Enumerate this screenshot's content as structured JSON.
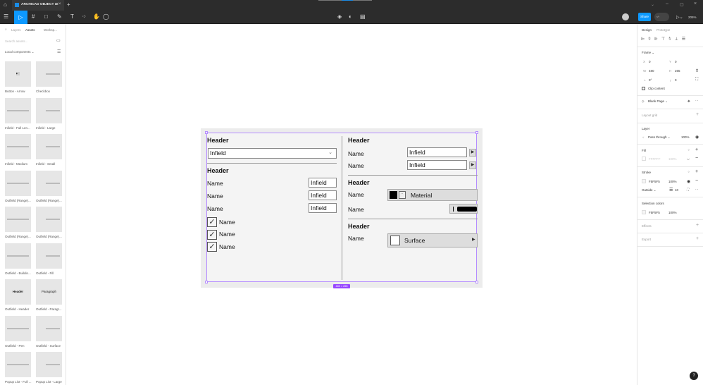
{
  "titlebar": {
    "tab_title": "ARCHICAD OBJECT UI"
  },
  "toolbar": {
    "share_label": "Share",
    "zoom": "205%"
  },
  "left_panel": {
    "tabs": [
      "Layers",
      "Assets",
      "Worksp..."
    ],
    "search_placeholder": "Search assets...",
    "section": "Local components",
    "components": [
      "Button - Arrow",
      "Checkbox",
      "Infield - Full Len...",
      "Infield - Large",
      "Infield - Medium",
      "Infield - Small",
      "Outfield (Range)...",
      "Outfield (Range)...",
      "Outfield (Range)...",
      "Outfield (Range)...",
      "Outfield - Buildin...",
      "Outfield - Fill",
      "Outfield - Header",
      "Outfield - Paragr...",
      "Outfield - Pen",
      "Outfield - Surface",
      "Popup List - Full ...",
      "Popup List - Large"
    ],
    "thumb_texts": {
      "header": "Header",
      "paragraph": "Paragraph"
    }
  },
  "frame": {
    "size_label": "480 × 265",
    "left": {
      "header1": "Header",
      "dropdown_value": "Infield",
      "header2": "Header",
      "rows": [
        {
          "name": "Name",
          "value": "Infield"
        },
        {
          "name": "Name",
          "value": "Infield"
        },
        {
          "name": "Name",
          "value": "Infield"
        }
      ],
      "checkboxes": [
        {
          "label": "Name",
          "checked": true
        },
        {
          "label": "Name",
          "checked": true
        },
        {
          "label": "Name",
          "checked": true
        }
      ]
    },
    "right": {
      "header1": "Header",
      "rows": [
        {
          "name": "Name",
          "value": "Infield"
        },
        {
          "name": "Name",
          "value": "Infield"
        }
      ],
      "header2": "Header",
      "material_name": "Name",
      "material_value": "Material",
      "pen_name": "Name",
      "header3": "Header",
      "surface_name": "Name",
      "surface_value": "Surface"
    }
  },
  "right_panel": {
    "tabs": [
      "Design",
      "Prototype"
    ],
    "frame_label": "Frame",
    "x": "0",
    "y": "0",
    "w": "480",
    "h": "265",
    "rotation": "0°",
    "radius": "0",
    "clip_content": "Clip content",
    "page": "Blank Page",
    "layout_grid": "Layout grid",
    "layer": "Layer",
    "blend": "Pass through",
    "layer_opacity": "100%",
    "fill": "Fill",
    "fill_hex": "FFFFFF",
    "fill_opacity": "100%",
    "stroke": "Stroke",
    "stroke_hex": "F5F5F5",
    "stroke_opacity": "100%",
    "stroke_pos": "Outside",
    "stroke_width": "10",
    "selection_colors": "Selection colors",
    "sel_hex": "F5F5F5",
    "sel_opacity": "100%",
    "effects": "Effects",
    "export": "Export"
  },
  "help": "?"
}
